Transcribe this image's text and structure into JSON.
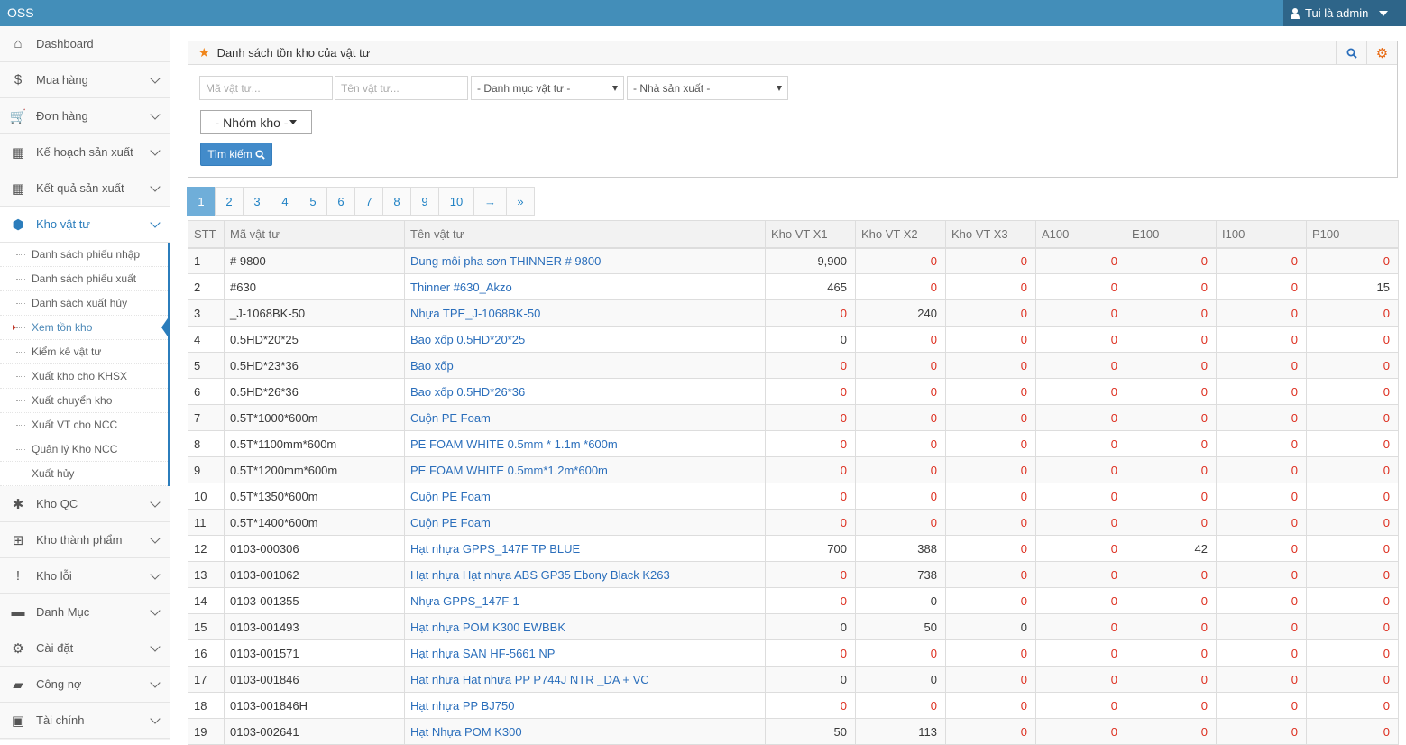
{
  "app": {
    "title": "OSS",
    "user_label": "Tui là admin"
  },
  "sidebar": {
    "items": [
      {
        "label": "Dashboard",
        "icon": "home-icon",
        "glyph": "⌂"
      },
      {
        "label": "Mua hàng",
        "icon": "dollar-icon",
        "glyph": "$"
      },
      {
        "label": "Đơn hàng",
        "icon": "cart-icon",
        "glyph": "🛒"
      },
      {
        "label": "Kế hoạch sản xuất",
        "icon": "calendar-icon",
        "glyph": "▦"
      },
      {
        "label": "Kết quả sản xuất",
        "icon": "calendar-icon",
        "glyph": "▦"
      },
      {
        "label": "Kho vật tư",
        "icon": "cube-icon",
        "glyph": "⬢"
      }
    ],
    "submenu": [
      "Danh sách phiếu nhập",
      "Danh sách phiếu xuất",
      "Danh sách xuất hủy",
      "Xem tồn kho",
      "Kiểm kê vật tư",
      "Xuất kho cho KHSX",
      "Xuất chuyển kho",
      "Xuất VT cho NCC",
      "Quản lý Kho NCC",
      "Xuất hủy"
    ],
    "items_after": [
      {
        "label": "Kho QC",
        "icon": "joomla-icon",
        "glyph": "✱"
      },
      {
        "label": "Kho thành phẩm",
        "icon": "windows-icon",
        "glyph": "⊞"
      },
      {
        "label": "Kho lỗi",
        "icon": "exclamation-icon",
        "glyph": "!"
      },
      {
        "label": "Danh Mục",
        "icon": "folder-icon",
        "glyph": "▬"
      },
      {
        "label": "Cài đặt",
        "icon": "cogs-icon",
        "glyph": "⚙"
      },
      {
        "label": "Công nợ",
        "icon": "book-icon",
        "glyph": "▰"
      },
      {
        "label": "Tài chính",
        "icon": "money-icon",
        "glyph": "▣"
      }
    ]
  },
  "widget": {
    "title": "Danh sách tồn kho của vật tư",
    "filters": {
      "code_placeholder": "Mã vật tư...",
      "name_placeholder": "Tên vật tư...",
      "category": "- Danh mục vật tư -",
      "manufacturer": "- Nhà sản xuất -",
      "group": "- Nhóm kho -"
    },
    "search_label": "Tìm kiếm"
  },
  "pagination": [
    "1",
    "2",
    "3",
    "4",
    "5",
    "6",
    "7",
    "8",
    "9",
    "10",
    "→",
    "»"
  ],
  "table": {
    "headers": [
      "STT",
      "Mã vật tư",
      "Tên vật tư",
      "Kho VT X1",
      "Kho VT X2",
      "Kho VT X3",
      "A100",
      "E100",
      "I100",
      "P100"
    ],
    "rows": [
      [
        "1",
        "# 9800",
        "Dung môi pha sơn THINNER # 9800",
        "9,900",
        "0",
        "0",
        "0",
        "0",
        "0",
        "0"
      ],
      [
        "2",
        "#630",
        "Thinner #630_Akzo",
        "465",
        "0",
        "0",
        "0",
        "0",
        "0",
        "15"
      ],
      [
        "3",
        "_J-1068BK-50",
        "Nhựa TPE_J-1068BK-50",
        "0",
        "240",
        "0",
        "0",
        "0",
        "0",
        "0"
      ],
      [
        "4",
        "0.5HD*20*25",
        "Bao xốp 0.5HD*20*25",
        "0",
        "0",
        "0",
        "0",
        "0",
        "0",
        "0"
      ],
      [
        "5",
        "0.5HD*23*36",
        "Bao xốp",
        "0",
        "0",
        "0",
        "0",
        "0",
        "0",
        "0"
      ],
      [
        "6",
        "0.5HD*26*36",
        "Bao xốp 0.5HD*26*36",
        "0",
        "0",
        "0",
        "0",
        "0",
        "0",
        "0"
      ],
      [
        "7",
        "0.5T*1000*600m",
        "Cuộn PE Foam",
        "0",
        "0",
        "0",
        "0",
        "0",
        "0",
        "0"
      ],
      [
        "8",
        "0.5T*1100mm*600m",
        "PE FOAM WHITE 0.5mm * 1.1m *600m",
        "0",
        "0",
        "0",
        "0",
        "0",
        "0",
        "0"
      ],
      [
        "9",
        "0.5T*1200mm*600m",
        "PE FOAM WHITE 0.5mm*1.2m*600m",
        "0",
        "0",
        "0",
        "0",
        "0",
        "0",
        "0"
      ],
      [
        "10",
        "0.5T*1350*600m",
        "Cuộn PE Foam",
        "0",
        "0",
        "0",
        "0",
        "0",
        "0",
        "0"
      ],
      [
        "11",
        "0.5T*1400*600m",
        "Cuộn PE Foam",
        "0",
        "0",
        "0",
        "0",
        "0",
        "0",
        "0"
      ],
      [
        "12",
        "0103-000306",
        "Hạt nhựa GPPS_147F TP BLUE",
        "700",
        "388",
        "0",
        "0",
        "42",
        "0",
        "0"
      ],
      [
        "13",
        "0103-001062",
        "Hạt nhựa Hạt nhựa ABS GP35 Ebony Black K263",
        "0",
        "738",
        "0",
        "0",
        "0",
        "0",
        "0"
      ],
      [
        "14",
        "0103-001355",
        "Nhựa GPPS_147F-1",
        "0",
        "0",
        "0",
        "0",
        "0",
        "0",
        "0"
      ],
      [
        "15",
        "0103-001493",
        "Hạt nhựa POM K300 EWBBK",
        "0",
        "50",
        "0",
        "0",
        "0",
        "0",
        "0"
      ],
      [
        "16",
        "0103-001571",
        "Hạt nhựa SAN HF-5661 NP",
        "0",
        "0",
        "0",
        "0",
        "0",
        "0",
        "0"
      ],
      [
        "17",
        "0103-001846",
        "Hạt nhựa Hạt nhựa PP P744J NTR _DA + VC",
        "0",
        "0",
        "0",
        "0",
        "0",
        "0",
        "0"
      ],
      [
        "18",
        "0103-001846H",
        "Hạt nhựa PP BJ750",
        "0",
        "0",
        "0",
        "0",
        "0",
        "0",
        "0"
      ],
      [
        "19",
        "0103-002641",
        "Hạt Nhựa POM K300",
        "50",
        "113",
        "0",
        "0",
        "0",
        "0",
        "0"
      ]
    ],
    "black_zero_cells": [
      [
        4,
        3
      ],
      [
        14,
        4
      ],
      [
        15,
        3
      ],
      [
        15,
        5
      ],
      [
        17,
        3
      ],
      [
        17,
        4
      ]
    ]
  },
  "colors": {
    "navbar": "#438eb9",
    "accent": "#2b7dbc",
    "zero_red": "#dd2e1f",
    "link": "#2a6ebb"
  }
}
